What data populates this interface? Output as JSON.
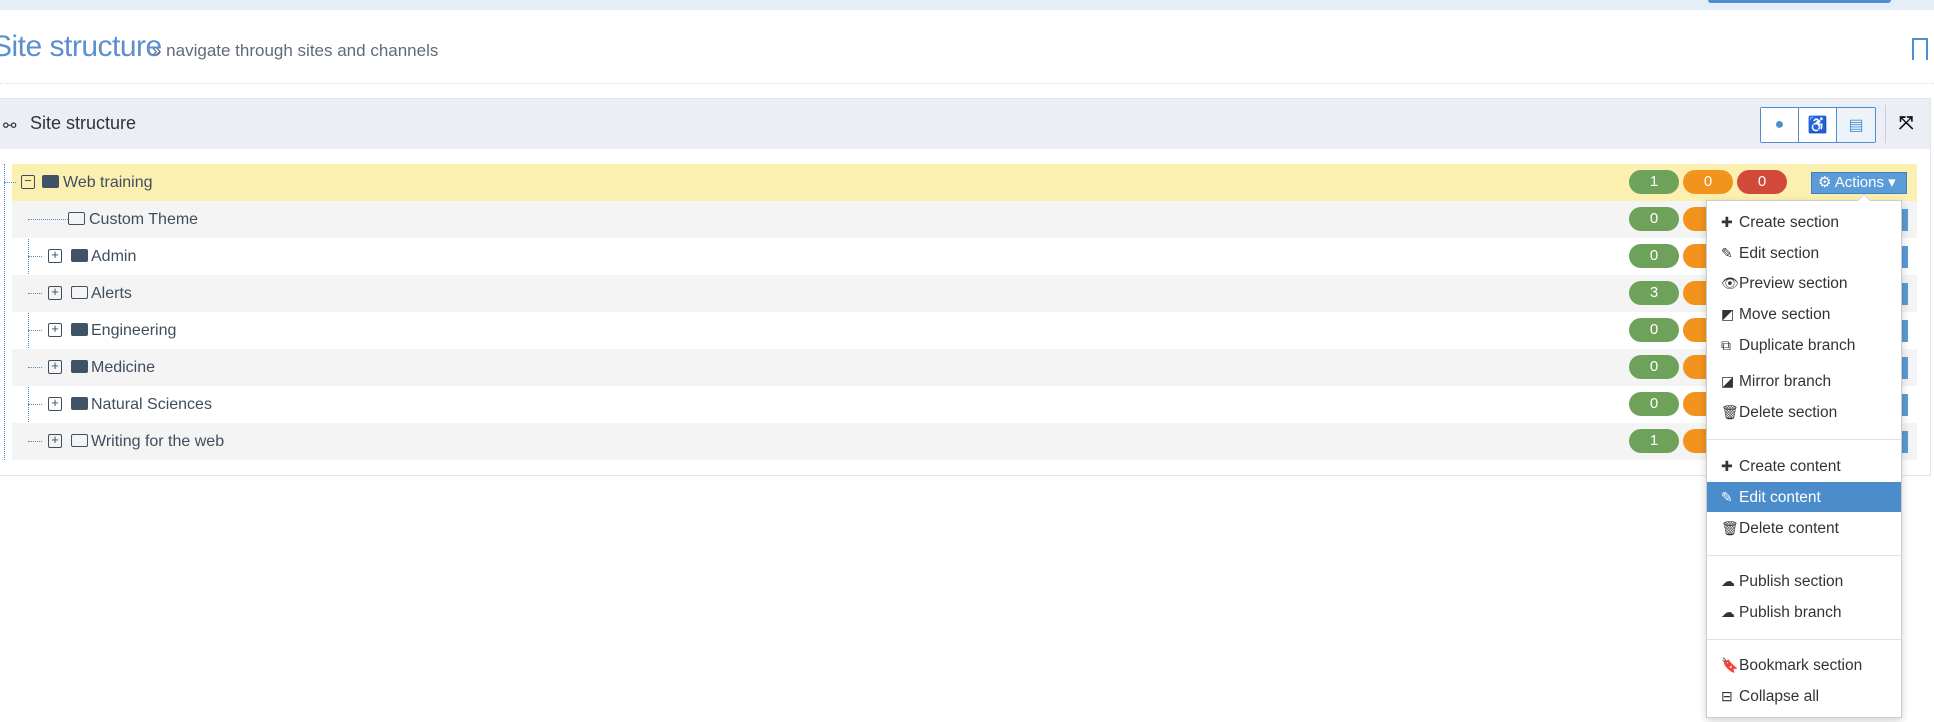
{
  "header": {
    "title": "Site structure",
    "subtitle": "» navigate through sites and channels"
  },
  "panel": {
    "title": "Site structure",
    "tool_icons": [
      "globe-icon",
      "wheelchair-icon",
      "document-icon"
    ]
  },
  "tree": {
    "root": {
      "label": "Web training",
      "counts": [
        1,
        0,
        0
      ],
      "actions_label": "Actions"
    },
    "children": [
      {
        "label": "Custom Theme",
        "icon": "folder-open",
        "expandable": false,
        "count": 0
      },
      {
        "label": "Admin",
        "icon": "folder-solid",
        "expandable": true,
        "count": 0
      },
      {
        "label": "Alerts",
        "icon": "folder-open",
        "expandable": true,
        "count": 3
      },
      {
        "label": "Engineering",
        "icon": "folder-solid",
        "expandable": true,
        "count": 0
      },
      {
        "label": "Medicine",
        "icon": "folder-solid",
        "expandable": true,
        "count": 0
      },
      {
        "label": "Natural Sciences",
        "icon": "folder-solid",
        "expandable": true,
        "count": 0
      },
      {
        "label": "Writing for the web",
        "icon": "folder-open",
        "expandable": true,
        "count": 1
      }
    ]
  },
  "menu": {
    "highlighted": "Edit content",
    "groups": [
      [
        {
          "label": "Create section",
          "icon": "✚"
        },
        {
          "label": "Edit section",
          "icon": "✎"
        },
        {
          "label": "Preview section",
          "icon": "👁"
        },
        {
          "label": "Move section",
          "icon": "◩"
        },
        {
          "label": "Duplicate branch",
          "icon": "⧉"
        },
        {
          "label": "Mirror branch",
          "icon": "◪"
        },
        {
          "label": "Delete section",
          "icon": "🗑"
        }
      ],
      [
        {
          "label": "Create content",
          "icon": "✚"
        },
        {
          "label": "Edit content",
          "icon": "✎"
        },
        {
          "label": "Delete content",
          "icon": "🗑"
        }
      ],
      [
        {
          "label": "Publish section",
          "icon": "☁"
        },
        {
          "label": "Publish branch",
          "icon": "☁"
        }
      ],
      [
        {
          "label": "Bookmark section",
          "icon": "🔖"
        },
        {
          "label": "Collapse all",
          "icon": "⊟"
        }
      ]
    ]
  },
  "colors": {
    "accent": "#4b8fd1",
    "green": "#6ea15a",
    "orange": "#f2931e",
    "red": "#d24b3a",
    "selected_row": "#fcf0b1"
  }
}
